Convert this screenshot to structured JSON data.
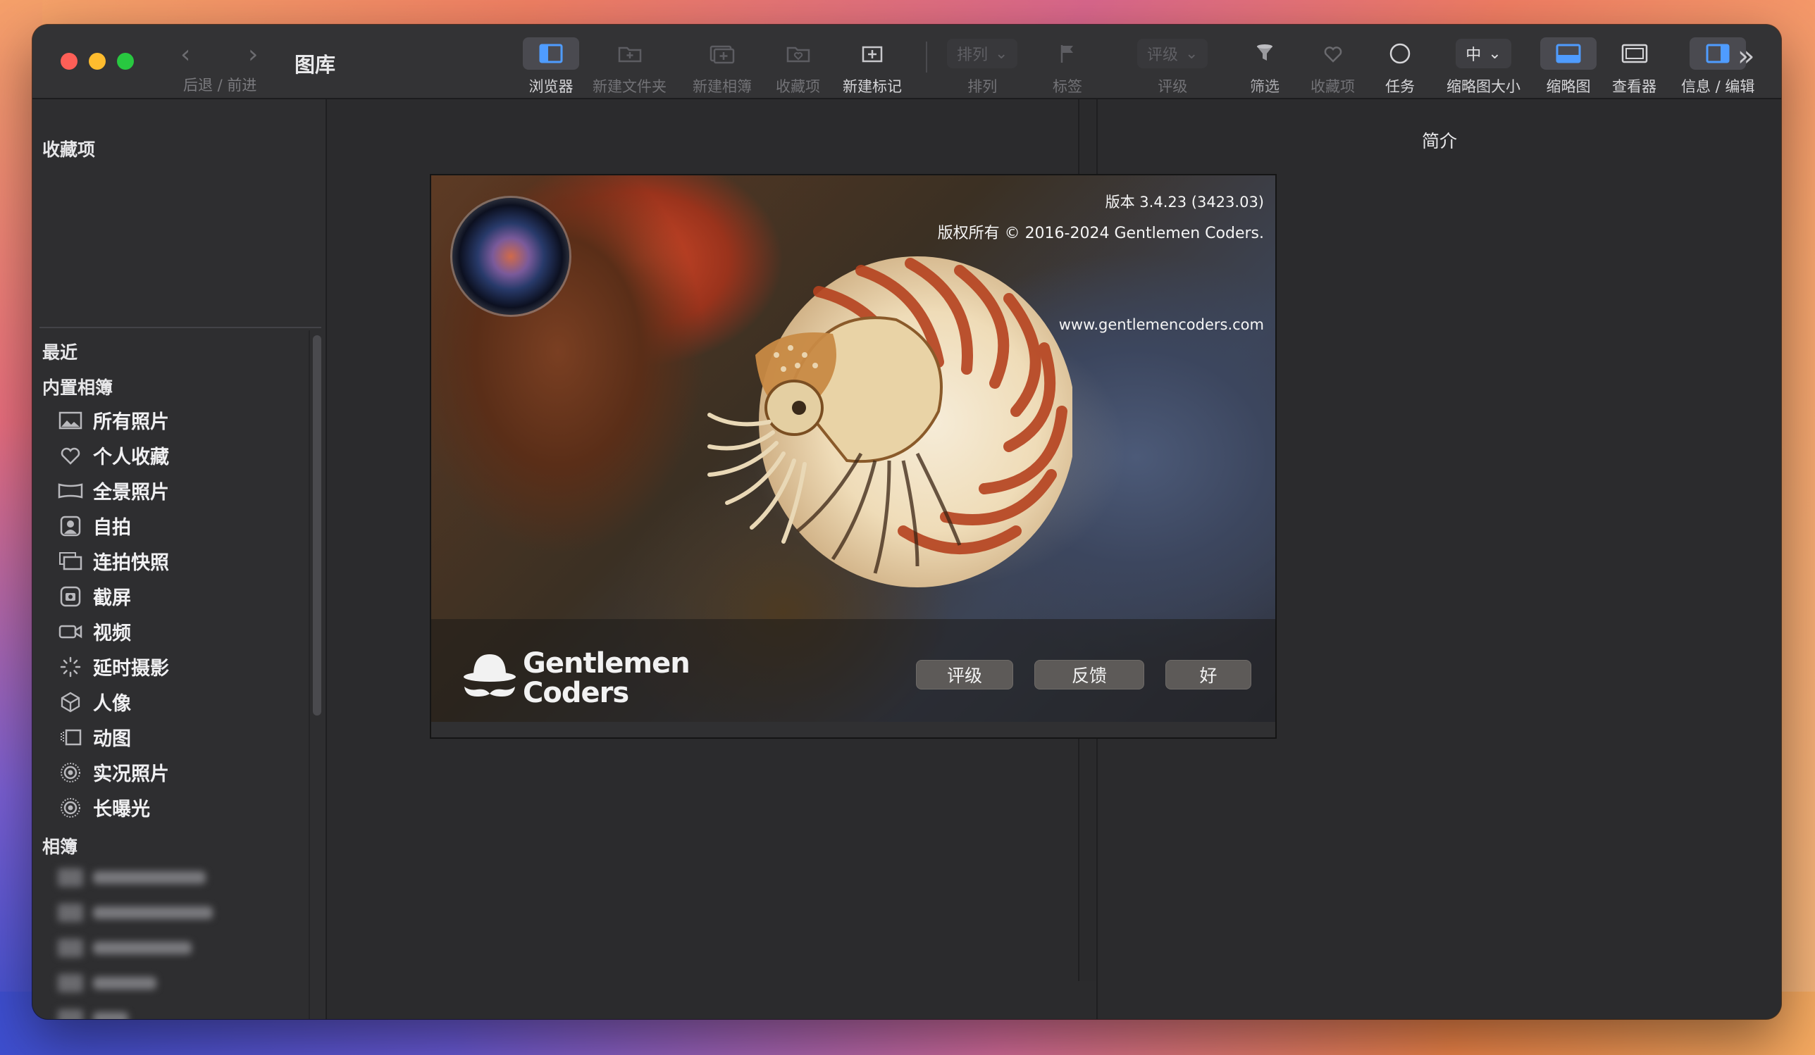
{
  "window": {
    "title": "图库",
    "nav_back_glyph": "‹",
    "nav_forward_glyph": "›",
    "nav_label": "后退 / 前进"
  },
  "toolbar": {
    "browser": "浏览器",
    "new_folder": "新建文件夹",
    "new_album": "新建相簿",
    "favorites": "收藏项",
    "new_tag": "新建标记",
    "sort_select": "排列",
    "sort": "排列",
    "tags": "标签",
    "rating_select": "评级",
    "rating": "评级",
    "filter": "筛选",
    "favorites2": "收藏项",
    "tasks": "任务",
    "thumb_size_select": "中",
    "thumb_size": "缩略图大小",
    "thumbnails": "缩略图",
    "viewer": "查看器",
    "info_edit": "信息 / 编辑",
    "more_glyph": "»"
  },
  "sidebar": {
    "favorites_header": "收藏项",
    "recent": "最近",
    "builtin_header": "内置相簿",
    "items": [
      {
        "label": "所有照片",
        "icon": "photos-icon"
      },
      {
        "label": "个人收藏",
        "icon": "heart-icon"
      },
      {
        "label": "全景照片",
        "icon": "panorama-icon"
      },
      {
        "label": "自拍",
        "icon": "selfie-icon"
      },
      {
        "label": "连拍快照",
        "icon": "burst-icon"
      },
      {
        "label": "截屏",
        "icon": "screenshot-icon"
      },
      {
        "label": "视频",
        "icon": "video-icon"
      },
      {
        "label": "延时摄影",
        "icon": "timelapse-icon"
      },
      {
        "label": "人像",
        "icon": "portrait-icon"
      },
      {
        "label": "动图",
        "icon": "animated-icon"
      },
      {
        "label": "实况照片",
        "icon": "live-photo-icon"
      },
      {
        "label": "长曝光",
        "icon": "long-exposure-icon"
      }
    ],
    "albums_header": "相簿"
  },
  "right_panel": {
    "title": "简介"
  },
  "about": {
    "version": "版本 3.4.23 (3423.03)",
    "copyright": "版权所有 © 2016-2024 Gentlemen Coders.",
    "website": "www.gentlemencoders.com",
    "logo_line1": "Gentlemen",
    "logo_line2": "Coders",
    "btn_rate": "评级",
    "btn_feedback": "反馈",
    "btn_ok": "好"
  }
}
